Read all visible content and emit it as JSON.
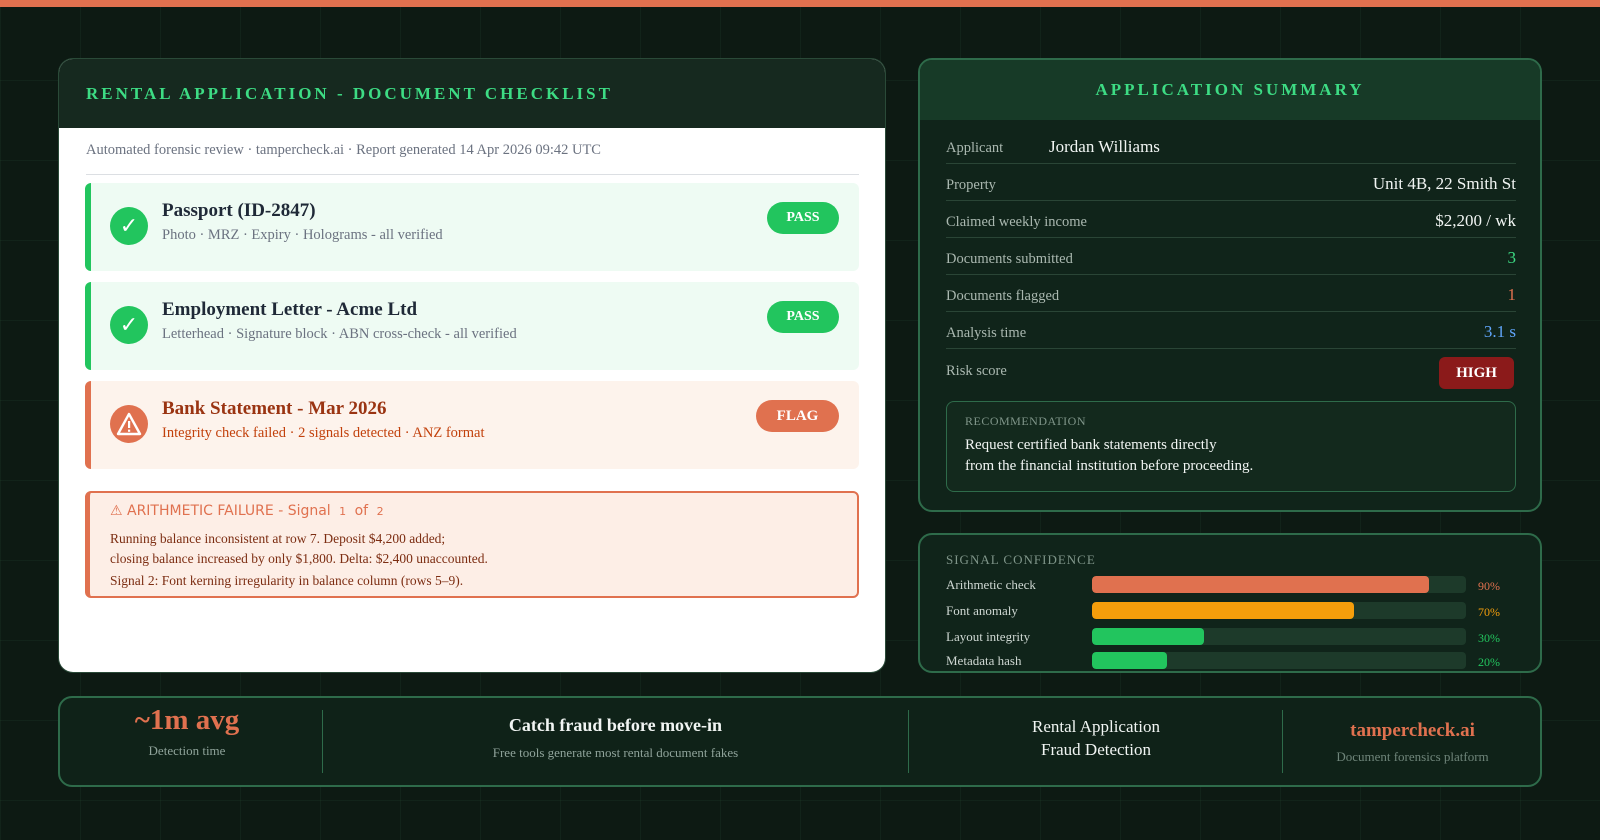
{
  "colors": {
    "accent": "#e0714f",
    "green": "#22c55e",
    "brand_green": "#3ddc84",
    "amber": "#f59e0b",
    "blue": "#60a5fa",
    "danger": "#8b1a1a",
    "background": "#0d1a13"
  },
  "checklist": {
    "title": "RENTAL APPLICATION - DOCUMENT CHECKLIST",
    "meta": "Automated forensic review · tampercheck.ai · Report generated 14 Apr 2026 09:42 UTC",
    "documents": [
      {
        "title": "Passport (ID-2847)",
        "detail": "Photo · MRZ · Expiry · Holograms - all verified",
        "status": "PASS",
        "icon": "check-icon"
      },
      {
        "title": "Employment Letter - Acme Ltd",
        "detail": "Letterhead · Signature block · ABN cross-check - all verified",
        "status": "PASS",
        "icon": "check-icon"
      },
      {
        "title": "Bank Statement - Mar 2026",
        "detail": "Integrity check failed · 2 signals detected · ANZ format",
        "status": "FLAG",
        "icon": "warning-icon"
      }
    ],
    "alert": {
      "title_prefix": "⚠ ARITHMETIC FAILURE - Signal",
      "signal_current": "1",
      "of_label": "of",
      "signal_total": "2",
      "lines": [
        "Running balance inconsistent at row 7. Deposit $4,200 added;",
        "closing balance increased by only $1,800. Delta: $2,400 unaccounted.",
        "Signal 2: Font kerning irregularity in balance column (rows 5–9)."
      ]
    }
  },
  "summary": {
    "title": "APPLICATION SUMMARY",
    "rows": [
      {
        "label": "Applicant",
        "value": "Jordan Williams"
      },
      {
        "label": "Property",
        "value": "Unit 4B, 22 Smith St"
      },
      {
        "label": "Claimed weekly income",
        "value": "$2,200 / wk"
      },
      {
        "label": "Documents submitted",
        "value": "3"
      },
      {
        "label": "Documents flagged",
        "value": "1"
      },
      {
        "label": "Analysis time",
        "value": "3.1 s"
      }
    ],
    "risk_label": "Risk score",
    "risk_value": "HIGH",
    "recommendation": {
      "label": "RECOMMENDATION",
      "line1": "Request certified bank statements directly",
      "line2": "from the financial institution before proceeding."
    }
  },
  "signals": {
    "title": "SIGNAL CONFIDENCE",
    "items": [
      {
        "name": "Arithmetic check",
        "percent_label": "90%",
        "level": 0.9,
        "color": "#e0714f"
      },
      {
        "name": "Font anomaly",
        "percent_label": "70%",
        "level": 0.7,
        "color": "#f59e0b"
      },
      {
        "name": "Layout integrity",
        "percent_label": "30%",
        "level": 0.3,
        "color": "#22c55e"
      },
      {
        "name": "Metadata hash",
        "percent_label": "20%",
        "level": 0.2,
        "color": "#22c55e"
      }
    ]
  },
  "footer": {
    "stat_value": "~1m avg",
    "stat_label": "Detection time",
    "headline": "Catch fraud before move-in",
    "subline": "Free tools generate most rental document fakes",
    "product_line1": "Rental Application",
    "product_line2": "Fraud Detection",
    "brand": "tampercheck.ai",
    "brand_sub": "Document forensics platform"
  }
}
